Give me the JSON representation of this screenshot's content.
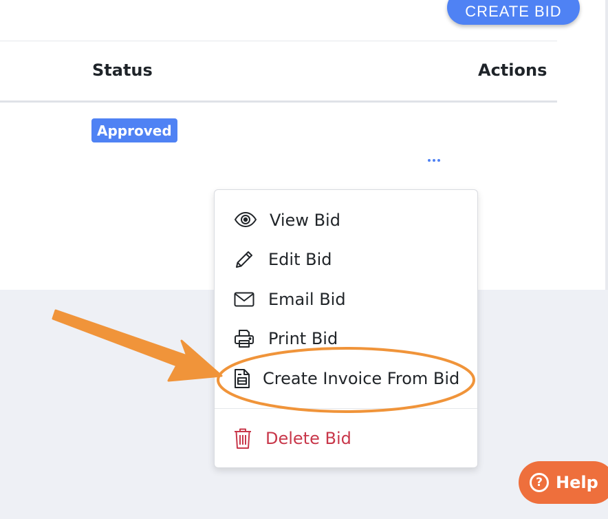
{
  "header": {
    "create_bid_label": "CREATE BID"
  },
  "table": {
    "columns": {
      "status": "Status",
      "actions": "Actions"
    },
    "rows": [
      {
        "status": "Approved"
      }
    ]
  },
  "actions_menu": {
    "items": [
      {
        "label": "View Bid",
        "icon": "eye-icon"
      },
      {
        "label": "Edit Bid",
        "icon": "pencil-icon"
      },
      {
        "label": "Email Bid",
        "icon": "envelope-icon"
      },
      {
        "label": "Print Bid",
        "icon": "printer-icon"
      },
      {
        "label": "Create Invoice From Bid",
        "icon": "invoice-document-icon",
        "highlighted": true
      },
      {
        "label": "Delete Bid",
        "icon": "trash-icon",
        "danger": true
      }
    ]
  },
  "help": {
    "label": "Help",
    "icon": "question-circle-icon"
  },
  "colors": {
    "primary": "#4f82f4",
    "danger": "#c8374a",
    "annotation": "#f0943a",
    "help": "#ee6f3c",
    "background": "#eef0f5"
  }
}
